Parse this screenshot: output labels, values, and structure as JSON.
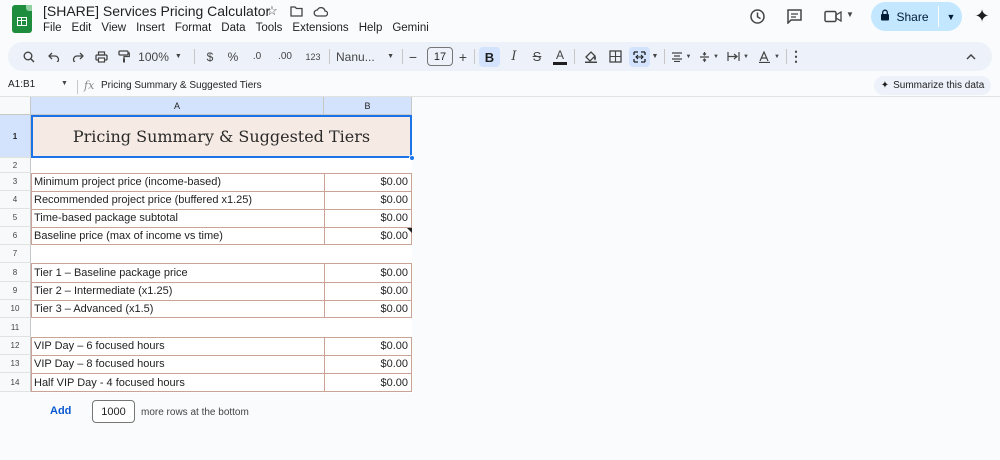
{
  "title_bar": {
    "doc_title": "[SHARE] Services Pricing Calculator",
    "icons": [
      "star-icon",
      "folder-icon",
      "cloud-icon"
    ]
  },
  "menu": [
    "File",
    "Edit",
    "View",
    "Insert",
    "Format",
    "Data",
    "Tools",
    "Extensions",
    "Help",
    "Gemini"
  ],
  "share": {
    "label": "Share"
  },
  "toolbar": {
    "zoom": "100%",
    "currency": "$",
    "percent": "%",
    "decrease_decimal": ".0",
    "increase_decimal": ".00",
    "number_format": "123",
    "font": "Nanu...",
    "font_size": "17",
    "minus": "−",
    "plus": "+"
  },
  "formula_bar": {
    "name_box": "A1:B1",
    "fx": "fx",
    "content": "Pricing Summary & Suggested Tiers",
    "summarize_label": "Summarize this data"
  },
  "columns": [
    "A",
    "B"
  ],
  "rows": [
    "1",
    "2",
    "3",
    "4",
    "5",
    "6",
    "7",
    "8",
    "9",
    "10",
    "11",
    "12",
    "13",
    "14"
  ],
  "sheet": {
    "header": "Pricing Summary & Suggested Tiers",
    "block1": [
      {
        "label": "Minimum project price (income-based)",
        "value": "$0.00"
      },
      {
        "label": "Recommended project price (buffered x1.25)",
        "value": "$0.00"
      },
      {
        "label": "Time-based package subtotal",
        "value": "$0.00"
      },
      {
        "label": "Baseline price (max of income vs time)",
        "value": "$0.00"
      }
    ],
    "block2": [
      {
        "label": "Tier 1 – Baseline package price",
        "value": "$0.00"
      },
      {
        "label": "Tier 2 – Intermediate (x1.25)",
        "value": "$0.00"
      },
      {
        "label": "Tier 3 – Advanced (x1.5)",
        "value": "$0.00"
      }
    ],
    "block3": [
      {
        "label": "VIP Day – 6 focused hours",
        "value": "$0.00"
      },
      {
        "label": "VIP Day – 8 focused hours",
        "value": "$0.00"
      },
      {
        "label": "Half VIP Day - 4 focused hours",
        "value": "$0.00"
      }
    ]
  },
  "footer": {
    "add_label": "Add",
    "rows_count": "1000",
    "rows_text": "more rows at the bottom"
  },
  "colors": {
    "header_fill": "#f6ebe4",
    "border": "#c9a395",
    "selection": "#1a73e8",
    "sheets_green": "#1e8e3e",
    "share_bg": "#c2e7ff"
  }
}
